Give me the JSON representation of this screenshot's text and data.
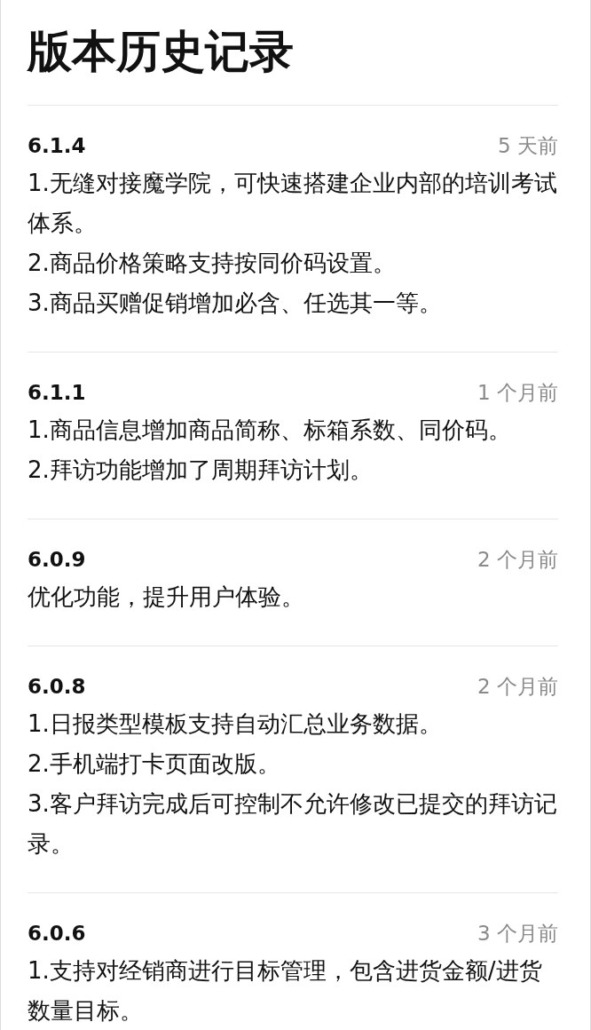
{
  "title": "版本历史记录",
  "versions": [
    {
      "version": "6.1.4",
      "time": "5 天前",
      "notes": [
        "1.无缝对接魔学院，可快速搭建企业内部的培训考试体系。",
        "2.商品价格策略支持按同价码设置。",
        "3.商品买赠促销增加必含、任选其一等。"
      ]
    },
    {
      "version": "6.1.1",
      "time": "1 个月前",
      "notes": [
        "1.商品信息增加商品简称、标箱系数、同价码。",
        "2.拜访功能增加了周期拜访计划。"
      ]
    },
    {
      "version": "6.0.9",
      "time": "2 个月前",
      "notes": [
        "优化功能，提升用户体验。"
      ]
    },
    {
      "version": "6.0.8",
      "time": "2 个月前",
      "notes": [
        "1.日报类型模板支持自动汇总业务数据。",
        "2.手机端打卡页面改版。",
        "3.客户拜访完成后可控制不允许修改已提交的拜访记录。"
      ]
    },
    {
      "version": "6.0.6",
      "time": "3 个月前",
      "notes": [
        "1.支持对经销商进行目标管理，包含进货金额/进货数量目标。"
      ]
    }
  ]
}
